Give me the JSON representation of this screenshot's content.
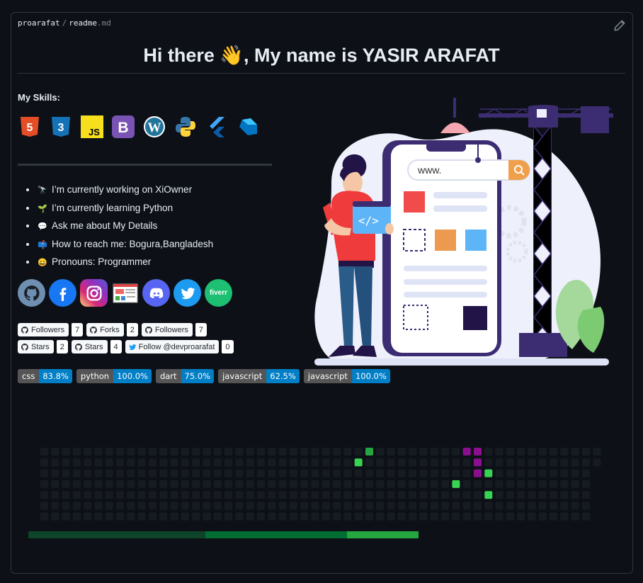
{
  "breadcrumb": {
    "owner": "proarafat",
    "separator": "/",
    "file": "readme",
    "ext": ".md"
  },
  "title": "Hi there 👋, My name is YASIR ARAFAT",
  "skills_label": "My Skills:",
  "skills": [
    {
      "name": "html5-icon",
      "color": "#e44d26",
      "text": "5"
    },
    {
      "name": "css3-icon",
      "color": "#1572b6",
      "text": "3"
    },
    {
      "name": "javascript-icon",
      "color": "#f7df1e",
      "text": "JS"
    },
    {
      "name": "bootstrap-icon",
      "color": "#7952b3",
      "text": "B"
    },
    {
      "name": "wordpress-icon",
      "color": "#21759b",
      "text": "W"
    },
    {
      "name": "python-icon",
      "color": "#3776ab",
      "text": ""
    },
    {
      "name": "flutter-icon",
      "color": "#42a5f5",
      "text": ""
    },
    {
      "name": "dart-icon",
      "color": "#0175c2",
      "text": ""
    }
  ],
  "facts": [
    {
      "emoji": "🔭",
      "text": "I’m currently working on XiOwner"
    },
    {
      "emoji": "🌱",
      "text": "I’m currently learning Python"
    },
    {
      "emoji": "💬",
      "text": "Ask me about My Details"
    },
    {
      "emoji": "📫",
      "text": "How to reach me: Bogura,Bangladesh"
    },
    {
      "emoji": "😄",
      "text": "Pronouns: Programmer"
    }
  ],
  "socials": [
    {
      "name": "github-icon",
      "bg": "#6e8fb1"
    },
    {
      "name": "facebook-icon",
      "bg": "#1877f2"
    },
    {
      "name": "instagram-icon",
      "bg": "#c13584"
    },
    {
      "name": "website-icon",
      "bg": "#f2f2f2"
    },
    {
      "name": "discord-icon",
      "bg": "#5865f2"
    },
    {
      "name": "twitter-icon",
      "bg": "#1d9bf0"
    },
    {
      "name": "fiverr-icon",
      "bg": "#1dbf73",
      "text": "fiverr"
    }
  ],
  "badges": [
    {
      "icon": "github-icon",
      "label": "Followers",
      "value": "7"
    },
    {
      "icon": "github-icon",
      "label": "Forks",
      "value": "2"
    },
    {
      "icon": "github-icon",
      "label": "Followers",
      "value": "7"
    },
    {
      "icon": "github-icon",
      "label": "Stars",
      "value": "2"
    },
    {
      "icon": "github-icon",
      "label": "Stars",
      "value": "4"
    },
    {
      "icon": "twitter-icon",
      "label": "Follow @devproarafat",
      "value": "0"
    }
  ],
  "languages": [
    {
      "name": "css",
      "value": "83.8%"
    },
    {
      "name": "python",
      "value": "100.0%"
    },
    {
      "name": "dart",
      "value": "75.0%"
    },
    {
      "name": "javascript",
      "value": "62.5%"
    },
    {
      "name": "javascript",
      "value": "100.0%"
    }
  ],
  "illustration": {
    "search_text": "www."
  },
  "colors": {
    "grid_empty": "#161b22",
    "grid_green": "#39d353",
    "grid_dark_green": "#26a641",
    "grid_purple": "#8b0f8f",
    "bar_segments": [
      "#0e4429",
      "#006d32",
      "#26a641"
    ]
  },
  "contrib": {
    "cols": 52,
    "rows": 7,
    "highlights": [
      {
        "c": 30,
        "r": 0,
        "k": "dark_green"
      },
      {
        "c": 29,
        "r": 1,
        "k": "green"
      },
      {
        "c": 39,
        "r": 0,
        "k": "purple"
      },
      {
        "c": 40,
        "r": 0,
        "k": "purple"
      },
      {
        "c": 40,
        "r": 1,
        "k": "purple"
      },
      {
        "c": 40,
        "r": 2,
        "k": "purple"
      },
      {
        "c": 41,
        "r": 2,
        "k": "green"
      },
      {
        "c": 38,
        "r": 3,
        "k": "green"
      },
      {
        "c": 41,
        "r": 4,
        "k": "green"
      }
    ],
    "missing_last_col_rows": [
      2,
      3,
      4,
      5,
      6
    ]
  },
  "progress_segments": [
    0.455,
    0.364,
    0.182
  ]
}
